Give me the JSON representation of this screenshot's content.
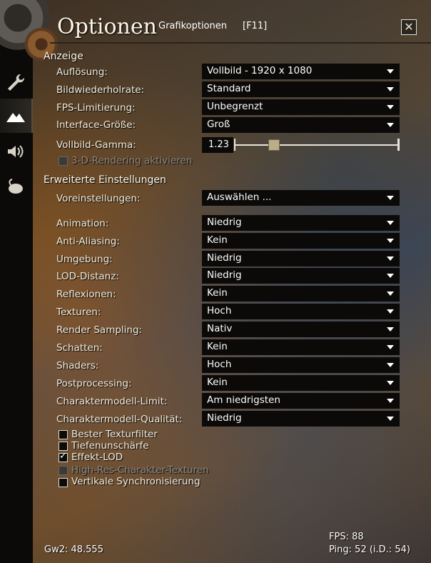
{
  "window": {
    "title": "Optionen",
    "subtitle": "Grafikoptionen",
    "hotkey": "[F11]",
    "close_label": "✕"
  },
  "sidebar": {
    "tabs": [
      {
        "icon": "wrench-icon"
      },
      {
        "icon": "mountains-icon",
        "active": true
      },
      {
        "icon": "speaker-icon"
      },
      {
        "icon": "mouse-icon"
      }
    ]
  },
  "display": {
    "heading": "Anzeige",
    "rows": [
      {
        "label": "Auflösung:",
        "value": "Vollbild - 1920 x 1080"
      },
      {
        "label": "Bildwiederholrate:",
        "value": "Standard"
      },
      {
        "label": "FPS-Limitierung:",
        "value": "Unbegrenzt"
      },
      {
        "label": "Interface-Größe:",
        "value": "Groß"
      }
    ],
    "gamma": {
      "label": "Vollbild-Gamma:",
      "value": "1.23",
      "level": 0.23
    },
    "render3d": {
      "label": "3-D-Rendering aktivieren",
      "checked": false,
      "disabled": true
    }
  },
  "advanced": {
    "heading": "Erweiterte Einstellungen",
    "preset": {
      "label": "Voreinstellungen:",
      "value": "Auswählen ..."
    },
    "rows": [
      {
        "label": "Animation:",
        "value": "Niedrig"
      },
      {
        "label": "Anti-Aliasing:",
        "value": "Kein"
      },
      {
        "label": "Umgebung:",
        "value": "Niedrig"
      },
      {
        "label": "LOD-Distanz:",
        "value": "Niedrig"
      },
      {
        "label": "Reflexionen:",
        "value": "Kein"
      },
      {
        "label": "Texturen:",
        "value": "Hoch"
      },
      {
        "label": "Render Sampling:",
        "value": "Nativ"
      },
      {
        "label": "Schatten:",
        "value": "Kein"
      },
      {
        "label": "Shaders:",
        "value": "Hoch"
      },
      {
        "label": "Postprocessing:",
        "value": "Kein"
      },
      {
        "label": "Charaktermodell-Limit:",
        "value": "Am niedrigsten"
      },
      {
        "label": "Charaktermodell-Qualität:",
        "value": "Niedrig"
      }
    ],
    "checkboxes": [
      {
        "label": "Bester Texturfilter",
        "checked": false,
        "disabled": false
      },
      {
        "label": "Tiefenunschärfe",
        "checked": false,
        "disabled": false
      },
      {
        "label": "Effekt-LOD",
        "checked": true,
        "disabled": false
      },
      {
        "label": "High-Res-Charakter-Texturen",
        "checked": false,
        "disabled": true
      },
      {
        "label": "Vertikale Synchronisierung",
        "checked": false,
        "disabled": false
      }
    ]
  },
  "footer": {
    "version": "Gw2: 48.555",
    "fps": "FPS: 88",
    "ping": "Ping: 52 (i.D.: 54)"
  }
}
